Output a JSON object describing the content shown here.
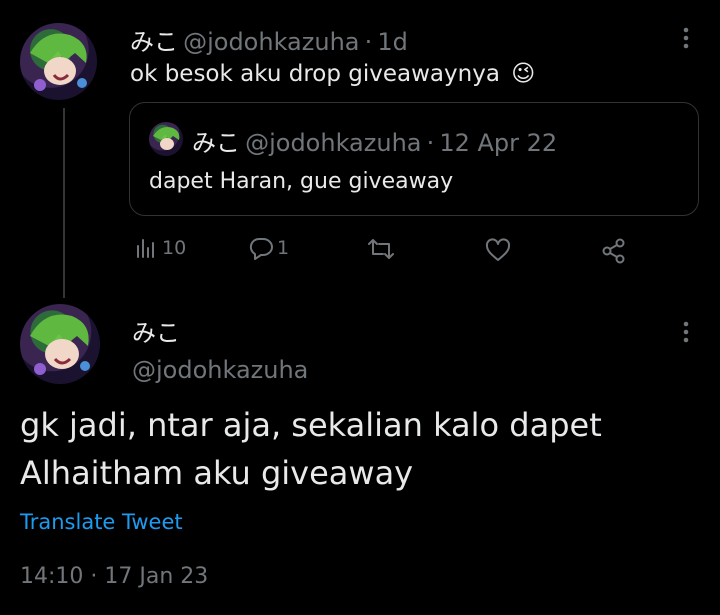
{
  "reply_tweet": {
    "display_name": "みこ",
    "handle": "@jodohkazuha",
    "separator": "·",
    "time": "1d",
    "text": "ok besok aku drop giveawaynya",
    "emoji": "😉",
    "quoted": {
      "display_name": "みこ",
      "handle": "@jodohkazuha",
      "separator": "·",
      "date": "12 Apr 22",
      "text": "dapet Haran, gue giveaway"
    },
    "actions": {
      "views_count": "10",
      "replies_count": "1",
      "retweets_count": "",
      "likes_count": ""
    }
  },
  "main_tweet": {
    "display_name": "みこ",
    "handle": "@jodohkazuha",
    "text_line1": "gk jadi, ntar aja, sekalian kalo dapet",
    "text_line2": "Alhaitham aku giveaway",
    "translate_label": "Translate Tweet",
    "timestamp": "14:10 · 17 Jan 23"
  },
  "colors": {
    "background": "#000000",
    "text": "#e7e9ea",
    "secondary": "#71767b",
    "link": "#1d9bf0",
    "border": "#2f3336"
  }
}
